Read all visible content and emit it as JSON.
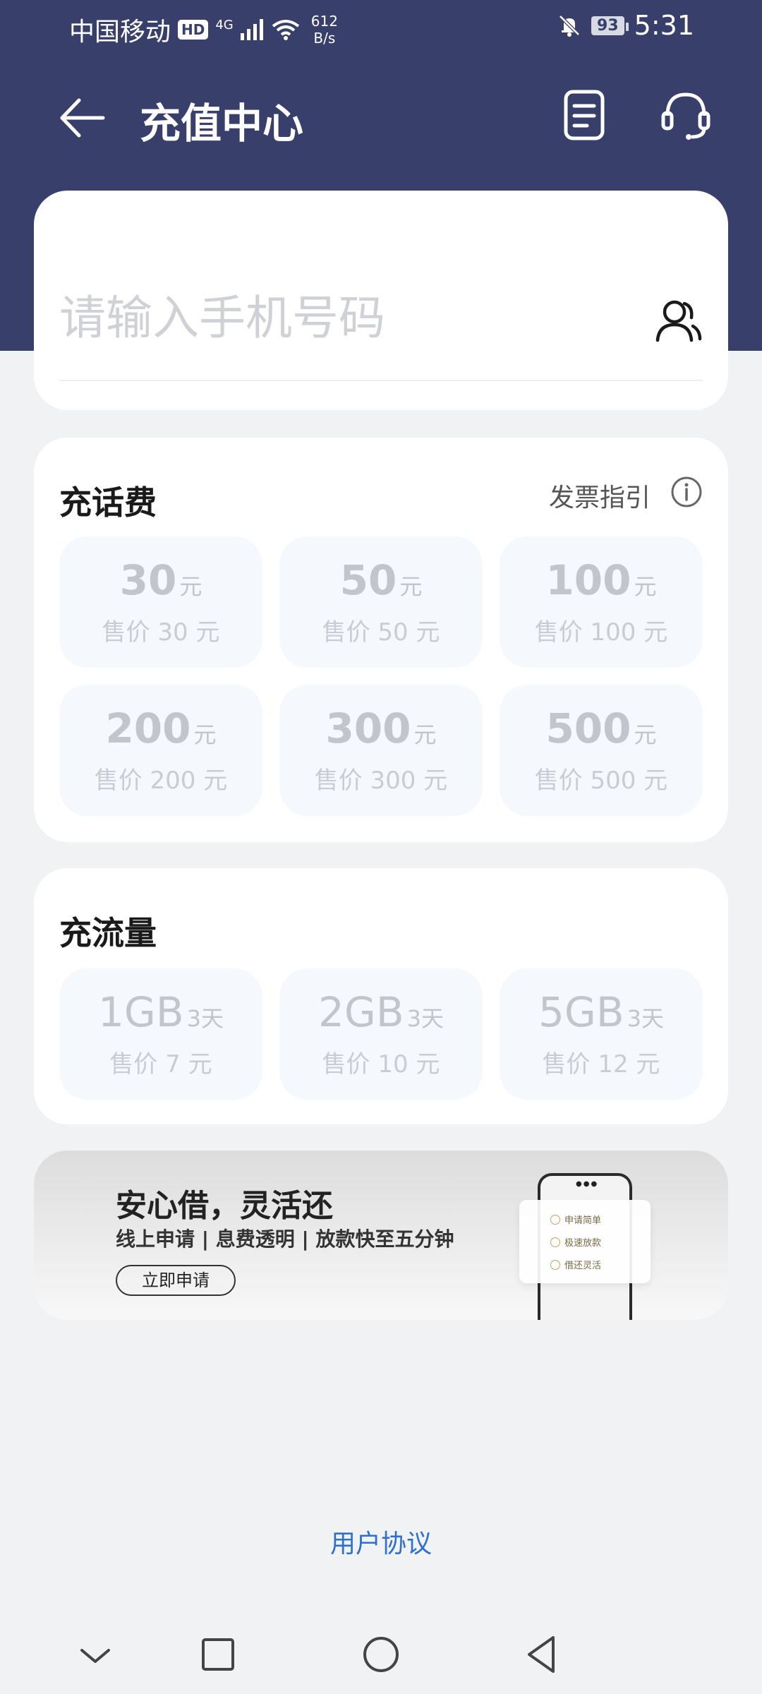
{
  "status_bar": {
    "carrier": "中国移动",
    "hd": "HD",
    "network": "4G",
    "speed_value": "612",
    "speed_unit": "B/s",
    "battery": "93",
    "time": "5:31"
  },
  "app_bar": {
    "title": "充值中心",
    "icons": [
      "back-arrow-icon",
      "document-list-icon",
      "headset-icon"
    ]
  },
  "phone_input": {
    "placeholder": "请输入手机号码",
    "value": ""
  },
  "bill_section": {
    "title": "充话费",
    "invoice_guide": "发票指引",
    "options": [
      {
        "amount": "30",
        "unit": "元",
        "price": "售价 30 元"
      },
      {
        "amount": "50",
        "unit": "元",
        "price": "售价 50 元"
      },
      {
        "amount": "100",
        "unit": "元",
        "price": "售价 100 元"
      },
      {
        "amount": "200",
        "unit": "元",
        "price": "售价 200 元"
      },
      {
        "amount": "300",
        "unit": "元",
        "price": "售价 300 元"
      },
      {
        "amount": "500",
        "unit": "元",
        "price": "售价 500 元"
      }
    ]
  },
  "data_section": {
    "title": "充流量",
    "options": [
      {
        "amount": "1GB",
        "unit": "3天",
        "price": "售价 7 元"
      },
      {
        "amount": "2GB",
        "unit": "3天",
        "price": "售价 10 元"
      },
      {
        "amount": "5GB",
        "unit": "3天",
        "price": "售价 12 元"
      }
    ]
  },
  "banner": {
    "title": "安心借，灵活还",
    "subtitle": "线上申请 | 息费透明 | 放款快至五分钟",
    "button": "立即申请",
    "features": [
      "申请简单",
      "极速放款",
      "借还灵活"
    ]
  },
  "footer": {
    "agreement": "用户协议"
  },
  "colors": {
    "header": "#383f6b",
    "link": "#2f6fcf",
    "tile_bg": "#f5f8fd"
  }
}
